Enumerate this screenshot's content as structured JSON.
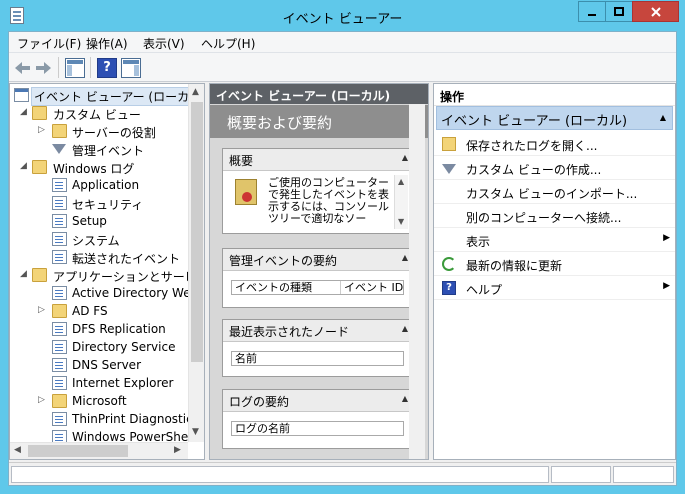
{
  "window": {
    "title": "イベント ビューアー"
  },
  "menu": [
    "ファイル(F)",
    "操作(A)",
    "表示(V)",
    "ヘルプ(H)"
  ],
  "toolbar": {
    "help_glyph": "?"
  },
  "tree": {
    "root": "イベント ビューアー (ローカル)",
    "custom_views": "カスタム ビュー",
    "server_roles": "サーバーの役割",
    "admin_events": "管理イベント",
    "windows_logs": "Windows ログ",
    "logs": [
      "Application",
      "セキュリティ",
      "Setup",
      "システム",
      "転送されたイベント"
    ],
    "apps_services": "アプリケーションとサービス ログ",
    "app_logs": [
      "Active Directory We",
      "AD FS",
      "DFS Replication",
      "Directory Service",
      "DNS Server",
      "Internet Explorer",
      "Microsoft",
      "ThinPrint Diagnostic",
      "Windows PowerShe"
    ]
  },
  "middle": {
    "header": "イベント ビューアー (ローカル)",
    "overview_title": "概要および要約",
    "overview_section": "概要",
    "overview_text": "ご使用のコンピューターで発生したイベントを表示するには、コンソール ツリーで適切なソー",
    "admin_summary": "管理イベントの要約",
    "admin_cols": [
      "イベントの種類",
      "イベント ID"
    ],
    "recent_nodes": "最近表示されたノード",
    "recent_col": "名前",
    "log_summary": "ログの要約",
    "log_col": "ログの名前"
  },
  "actions": {
    "header": "操作",
    "group": "イベント ビューアー (ローカル)",
    "items": [
      "保存されたログを開く...",
      "カスタム ビューの作成...",
      "カスタム ビューのインポート...",
      "別のコンピューターへ接続...",
      "表示",
      "最新の情報に更新",
      "ヘルプ"
    ]
  }
}
